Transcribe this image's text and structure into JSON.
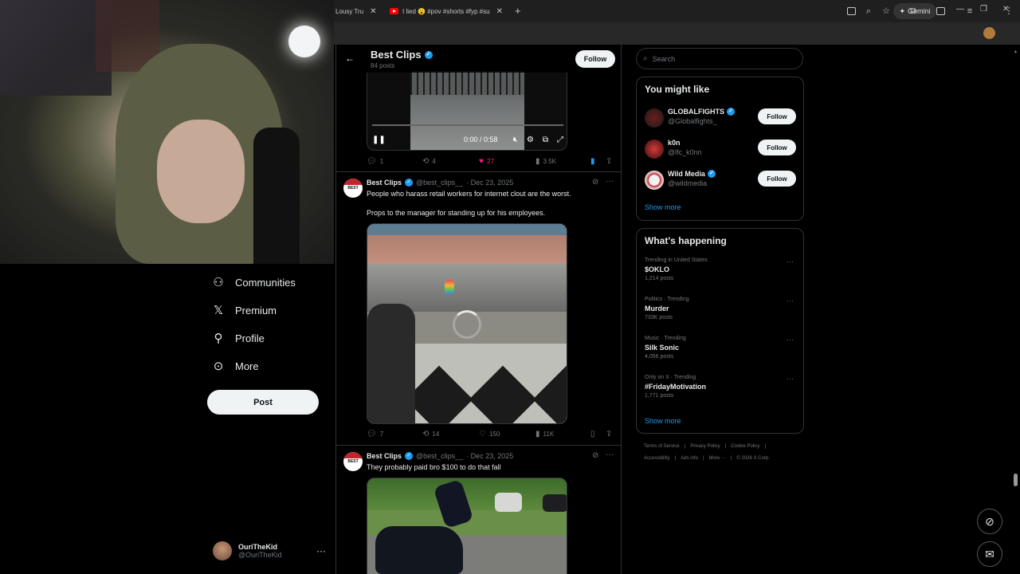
{
  "browser": {
    "tabs": [
      {
        "label": "Lousy Tru"
      },
      {
        "label": "I lied 😮 #pov #shorts #fyp #su"
      }
    ],
    "gemini_label": "Gemini",
    "new_tab": "+",
    "window": {
      "minimize": "—",
      "maximize": "❐",
      "close": "✕"
    }
  },
  "left_nav": {
    "items": [
      {
        "label": "Communities",
        "icon": "communities-icon"
      },
      {
        "label": "Premium",
        "icon": "x-logo-icon"
      },
      {
        "label": "Profile",
        "icon": "profile-icon"
      },
      {
        "label": "More",
        "icon": "more-circle-icon"
      }
    ],
    "post_label": "Post",
    "account": {
      "name": "OuriTheKid",
      "handle": "@OuriTheKid",
      "more": "···"
    }
  },
  "profile_header": {
    "title": "Best Clips",
    "posts": "84 posts",
    "follow_label": "Follow"
  },
  "video1": {
    "time": "0:00 / 0:58",
    "progress": 0,
    "actions": {
      "replies": "1",
      "reposts": "4",
      "likes": "27",
      "views": "3.5K"
    }
  },
  "tweets": [
    {
      "name": "Best Clips",
      "handle": "@best_clips__",
      "date": "· Dec 23, 2025",
      "avatar_text": "BEST",
      "line1": "People who harass retail workers for internet clout are the worst.",
      "line2": "Props to the manager for standing up for his employees.",
      "actions": {
        "replies": "7",
        "reposts": "14",
        "likes": "150",
        "views": "11K"
      }
    },
    {
      "name": "Best Clips",
      "handle": "@best_clips__",
      "date": "· Dec 23, 2025",
      "avatar_text": "BEST",
      "line1": "They probably paid bro $100 to do that fall"
    }
  ],
  "search": {
    "placeholder": "Search"
  },
  "who_to_follow": {
    "title": "You might like",
    "users": [
      {
        "name": "GLOBALFIGHTS",
        "handle": "@Globalfights_",
        "verified": true,
        "follow": "Follow"
      },
      {
        "name": "k0n",
        "handle": "@lfc_k0nn",
        "verified": false,
        "follow": "Follow"
      },
      {
        "name": "Wild Media",
        "handle": "@wildmedia",
        "verified": true,
        "follow": "Follow"
      }
    ],
    "show_more": "Show more"
  },
  "trends": {
    "title": "What's happening",
    "items": [
      {
        "category": "Trending in United States",
        "name": "$OKLO",
        "count": "1,214 posts"
      },
      {
        "category": "Politics · Trending",
        "name": "Murder",
        "count": "733K posts"
      },
      {
        "category": "Music · Trending",
        "name": "Silk Sonic",
        "count": "4,056 posts"
      },
      {
        "category": "Only on X · Trending",
        "name": "#FridayMotivation",
        "count": "1,771 posts"
      }
    ],
    "show_more": "Show more"
  },
  "footer": {
    "row1": [
      "Terms of Service",
      "|",
      "Privacy Policy",
      "|",
      "Cookie Policy",
      "|"
    ],
    "row2": [
      "Accessibility",
      "|",
      "Ads info",
      "|",
      "More ···",
      "|",
      "© 2026 X Corp."
    ]
  },
  "colors": {
    "accent": "#1d9bf0",
    "like": "#f91880",
    "border": "#2f3336",
    "muted": "#71767b"
  }
}
